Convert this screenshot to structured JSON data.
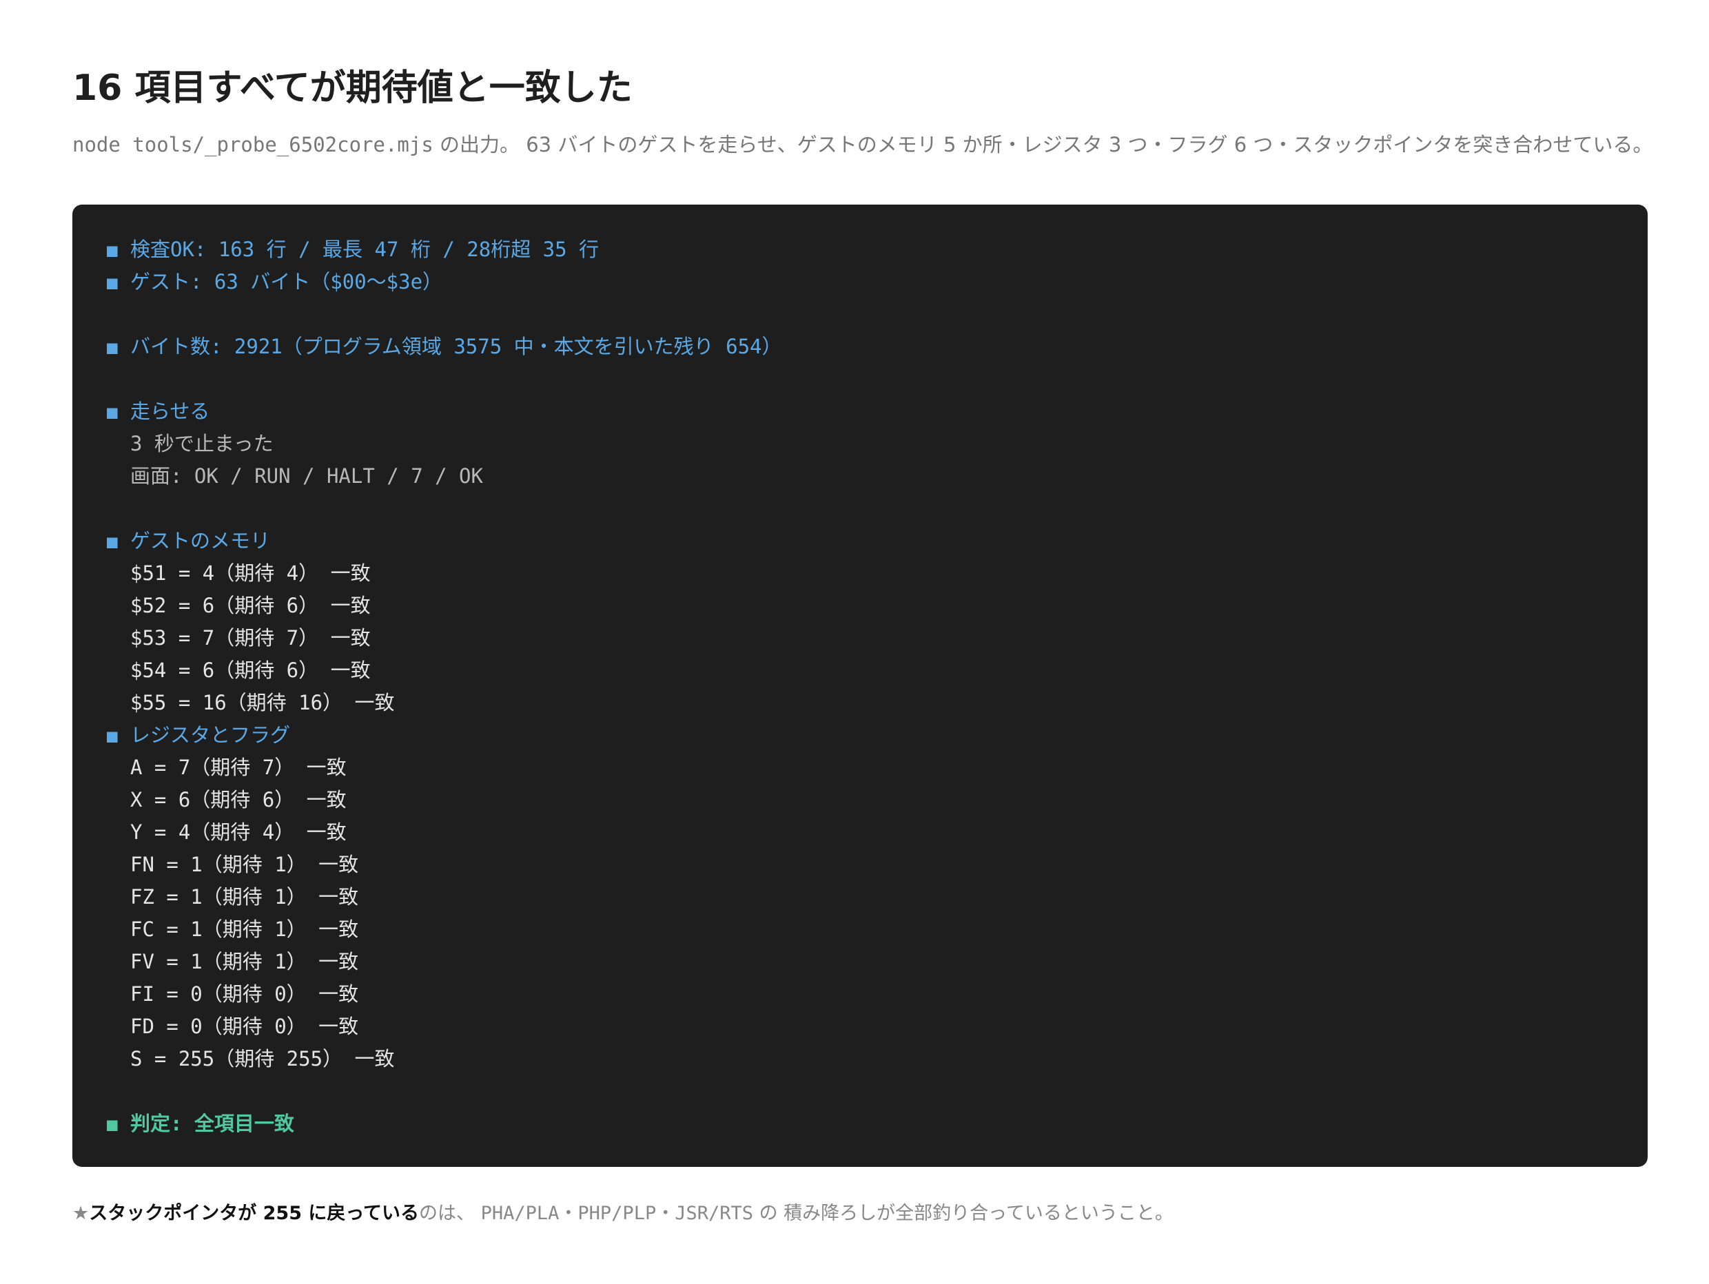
{
  "page": {
    "title": "16 項目すべてが期待値と一致した",
    "subtitle": {
      "command": "node tools/_probe_6502core.mjs",
      "text": " の出力。 63 バイトのゲストを走らせ、ゲストのメモリ 5 か所・レジスタ 3 つ・フラグ 6 つ・スタックポインタを突き合わせている。"
    }
  },
  "terminal": {
    "bullet": "■",
    "check_line": "検査OK: 163 行 / 最長 47 桁 / 28桁超 35 行",
    "guest_line": "ゲスト: 63 バイト（$00〜$3e）",
    "bytes_line": "バイト数: 2921（プログラム領域 3575 中・本文を引いた残り 654）",
    "run": {
      "heading": "走らせる",
      "lines": [
        "3 秒で止まった",
        "画面: OK / RUN / HALT / 7 / OK"
      ]
    },
    "memory": {
      "heading": "ゲストのメモリ",
      "rows": [
        "$51 = 4（期待 4） 一致",
        "$52 = 6（期待 6） 一致",
        "$53 = 7（期待 7） 一致",
        "$54 = 6（期待 6） 一致",
        "$55 = 16（期待 16） 一致"
      ]
    },
    "registers": {
      "heading": "レジスタとフラグ",
      "rows": [
        "A = 7（期待 7） 一致",
        "X = 6（期待 6） 一致",
        "Y = 4（期待 4） 一致",
        "FN = 1（期待 1） 一致",
        "FZ = 1（期待 1） 一致",
        "FC = 1（期待 1） 一致",
        "FV = 1（期待 1） 一致",
        "FI = 0（期待 0） 一致",
        "FD = 0（期待 0） 一致",
        "S = 255（期待 255） 一致"
      ]
    },
    "verdict": "判定: 全項目一致"
  },
  "footer": {
    "star": "★",
    "bold": "スタックポインタが 255 に戻っている",
    "text1": "のは、 ",
    "code": "PHA/PLA・PHP/PLP・JSR/RTS",
    "text2": " の 積み降ろしが全部釣り合っているということ。"
  },
  "colors": {
    "heading_blue": "#5aa9e6",
    "verdict_green": "#4ec9a0",
    "terminal_bg": "#1e1e1e"
  }
}
